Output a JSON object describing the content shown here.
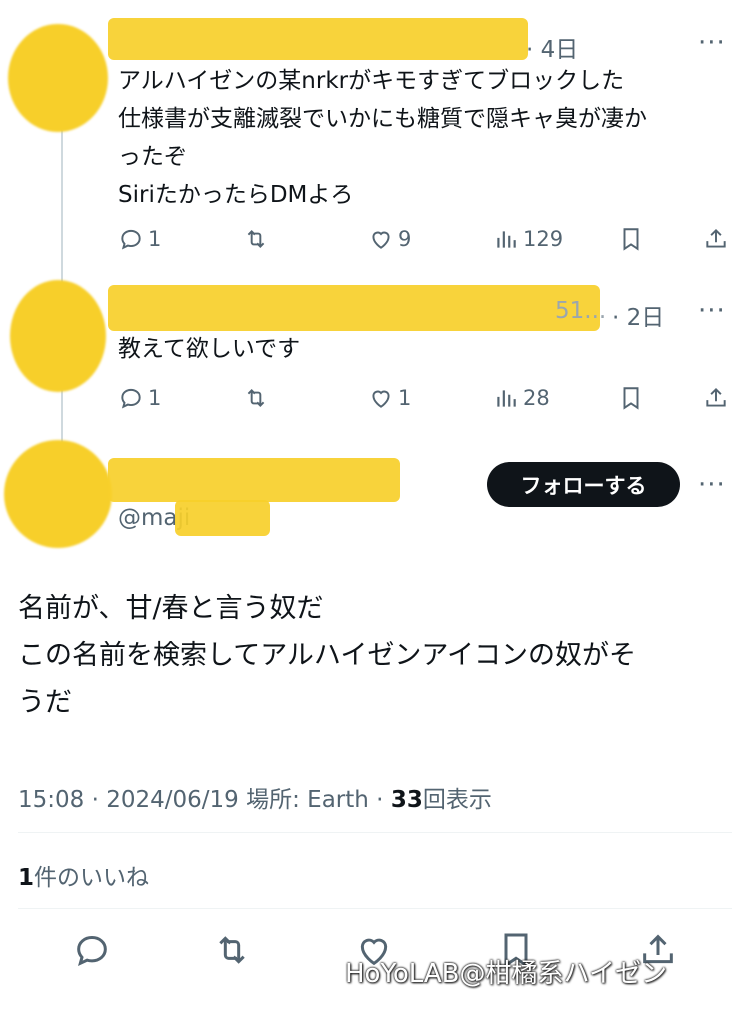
{
  "colors": {
    "highlight": "#f7cf2a",
    "text": "#0f1419",
    "muted": "#536471",
    "button": "#0f1419"
  },
  "replies": [
    {
      "time": "· 4日",
      "lines": [
        "アルハイゼンの某nrkrがキモすぎてブロックした",
        "仕様書が支離滅裂でいかにも糖質で隠キャ臭が凄か",
        "ったぞ",
        "SiriたかったらDMよろ"
      ],
      "actions": {
        "reply": "1",
        "retweet": "",
        "like": "9",
        "views": "129"
      }
    },
    {
      "time": "· 2日",
      "handle_tail": "51...",
      "lines": [
        "教えて欲しいです"
      ],
      "actions": {
        "reply": "1",
        "retweet": "",
        "like": "1",
        "views": "28"
      }
    }
  ],
  "main_post": {
    "handle": "@maji",
    "follow_label": "フォローする",
    "lines": [
      "名前が、甘/春と言う奴だ",
      "この名前を検索してアルハイゼンアイコンの奴がそ",
      "うだ"
    ],
    "time": "15:08",
    "date": "2024/06/19",
    "place_label": "場所: Earth",
    "views_count": "33",
    "views_label": "回表示",
    "likes_count": "1",
    "likes_label": "件のいいね"
  },
  "more_icon": "···",
  "watermark": "HoYoLAB@柑橘系ハイゼン"
}
